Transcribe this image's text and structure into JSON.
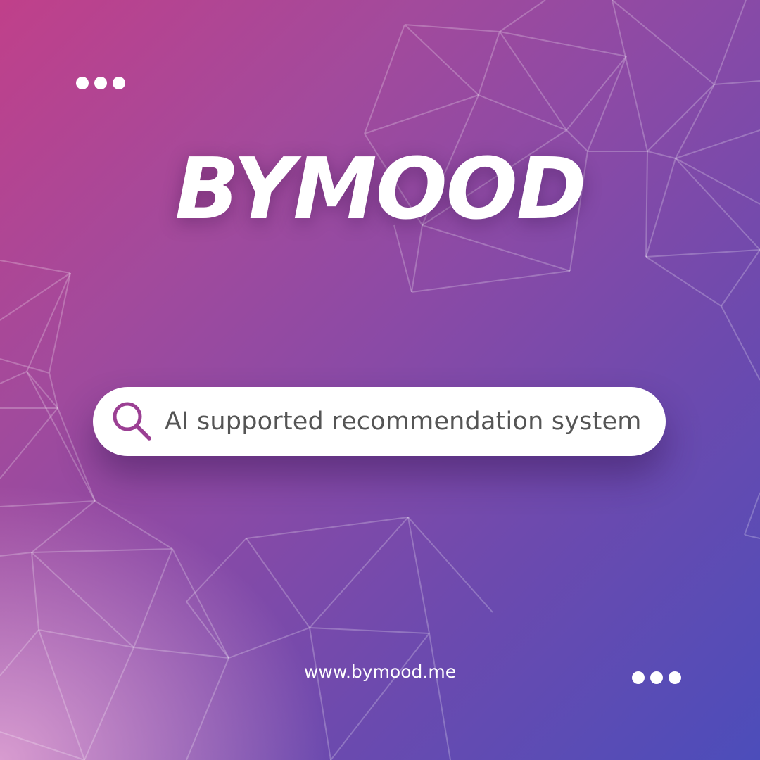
{
  "brand": {
    "title": "BYMOOD"
  },
  "search": {
    "text": "AI supported recommendation system",
    "icon": "search-icon",
    "icon_color": "#9b3f93"
  },
  "footer": {
    "website": "www.bymood.me"
  },
  "colors": {
    "gradient_start": "#c0408a",
    "gradient_end": "#4c4dba",
    "text": "#ffffff"
  }
}
